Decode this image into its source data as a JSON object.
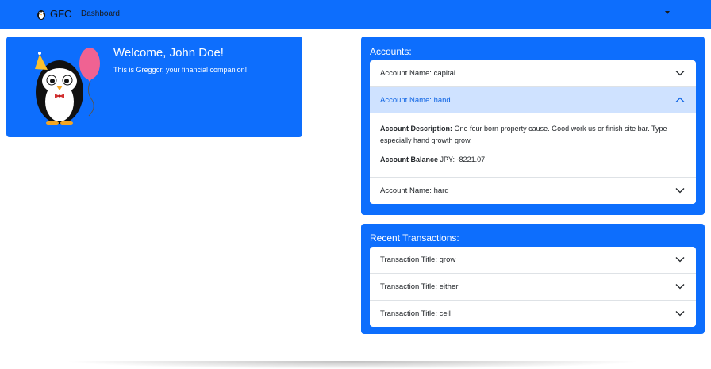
{
  "navbar": {
    "brand": "GFC",
    "links": [
      "Dashboard"
    ],
    "brand_color": "#0d6efd"
  },
  "welcome": {
    "title": "Welcome, John Doe!",
    "subtitle": "This is Greggor, your financial companion!"
  },
  "accounts": {
    "title": "Accounts:",
    "items": [
      {
        "label": "Account Name: capital",
        "expanded": false
      },
      {
        "label": "Account Name: hand",
        "expanded": true,
        "description_label": "Account Description:",
        "description": "One four born property cause. Good work us or finish site bar. Type especially hand growth grow.",
        "balance_label": "Account Balance",
        "balance": "JPY: -8221.07"
      },
      {
        "label": "Account Name: hard",
        "expanded": false
      }
    ]
  },
  "transactions": {
    "title": "Recent Transactions:",
    "items": [
      {
        "label": "Transaction Title: grow"
      },
      {
        "label": "Transaction Title: either"
      },
      {
        "label": "Transaction Title: cell"
      }
    ]
  },
  "icons": {
    "brand_logo": "penguin-icon",
    "collapse": "chevron-down-icon",
    "expand": "chevron-up-icon"
  }
}
